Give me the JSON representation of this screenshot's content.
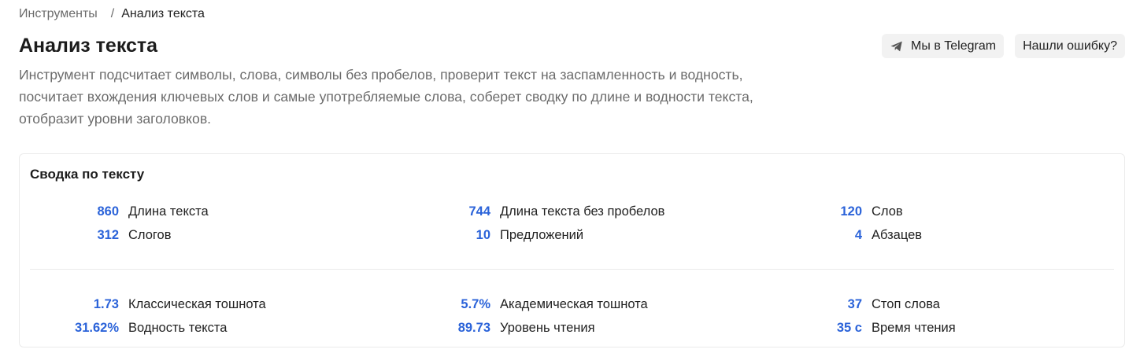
{
  "breadcrumb": {
    "parent": "Инструменты",
    "separator": "/",
    "current": "Анализ текста"
  },
  "header": {
    "title": "Анализ текста",
    "description": "Инструмент подсчитает символы, слова, символы без пробелов, проверит текст на заспамленность и водность, посчитает вхождения ключевых слов и самые употребляемые слова, соберет сводку по длине и водности текста, отобразит уровни заголовков.",
    "telegram_button": "Мы в Telegram",
    "telegram_icon": "paper-plane-icon",
    "report_button": "Нашли ошибку?"
  },
  "summary": {
    "title": "Сводка по тексту",
    "stats": [
      {
        "value": "860",
        "label": "Длина текста"
      },
      {
        "value": "744",
        "label": "Длина текста без пробелов"
      },
      {
        "value": "120",
        "label": "Слов"
      },
      {
        "value": "312",
        "label": "Слогов"
      },
      {
        "value": "10",
        "label": "Предложений"
      },
      {
        "value": "4",
        "label": "Абзацев"
      },
      {
        "value": "1.73",
        "label": "Классическая тошнота"
      },
      {
        "value": "5.7%",
        "label": "Академическая тошнота"
      },
      {
        "value": "37",
        "label": "Стоп слова"
      },
      {
        "value": "31.62%",
        "label": "Водность текста"
      },
      {
        "value": "89.73",
        "label": "Уровень чтения"
      },
      {
        "value": "35 с",
        "label": "Время чтения"
      }
    ]
  },
  "colors": {
    "accent": "#2b63d9",
    "muted_text": "#6b6b6b",
    "button_bg": "#f2f2f2"
  }
}
